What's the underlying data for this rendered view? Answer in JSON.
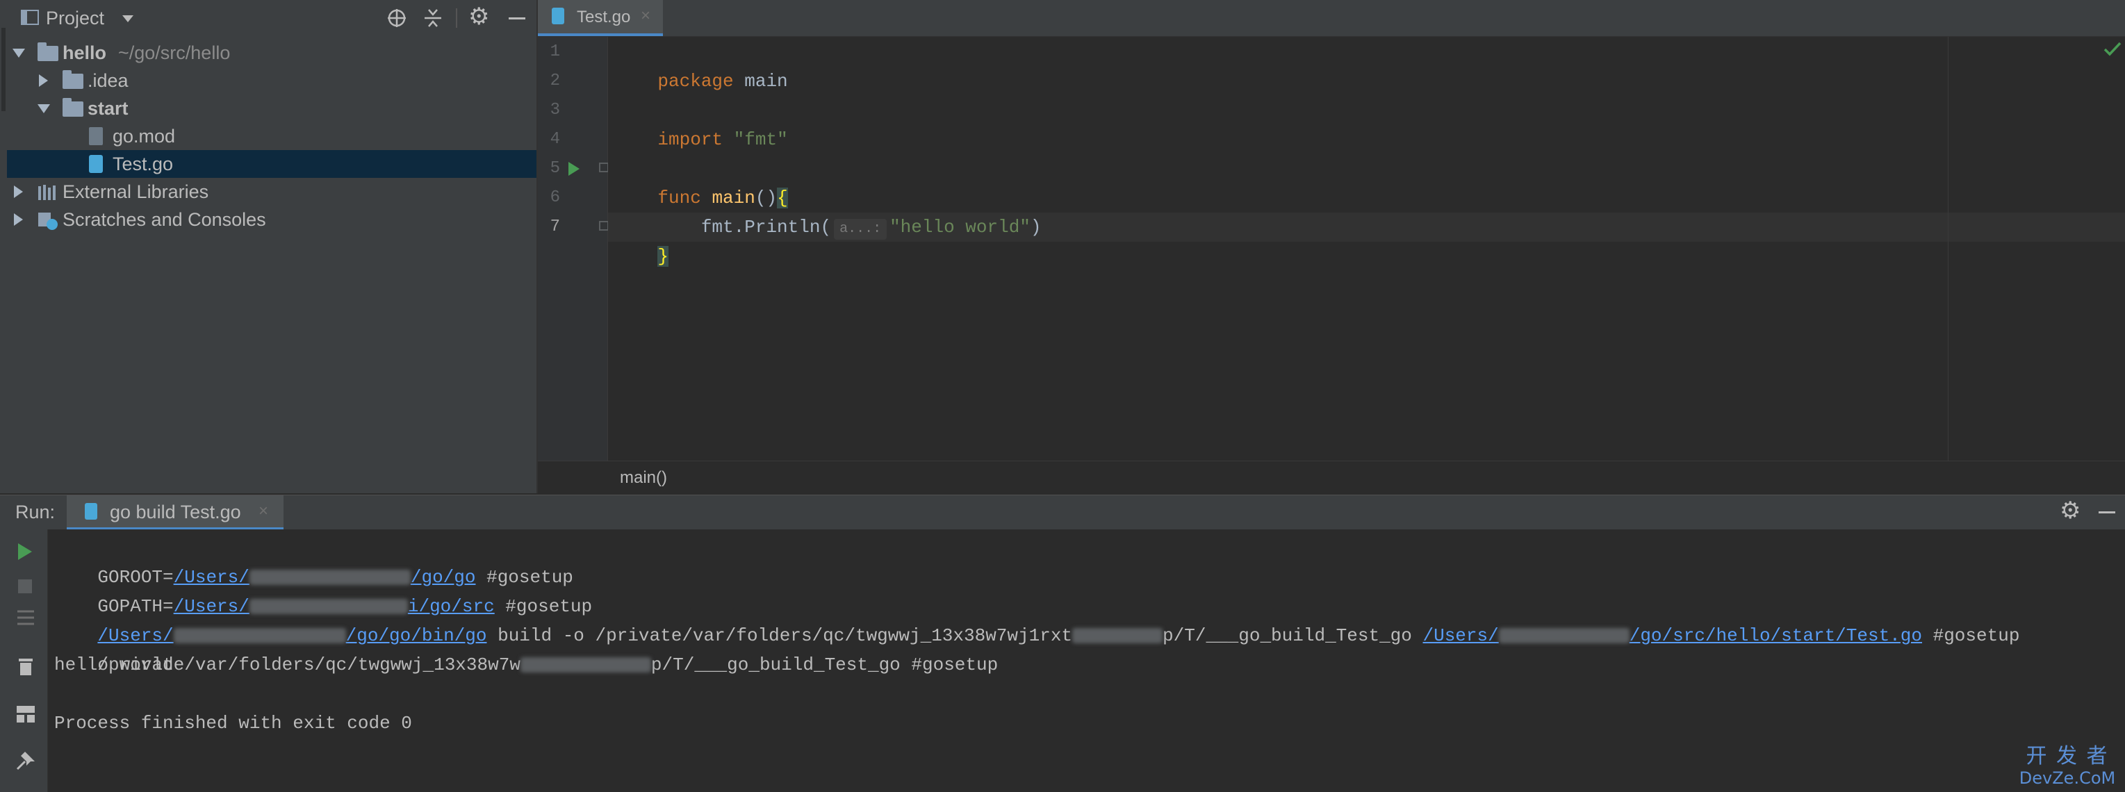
{
  "project_panel": {
    "title": "Project",
    "tree": [
      {
        "name": "hello",
        "path": "~/go/src/hello"
      },
      {
        "name": ".idea"
      },
      {
        "name": "start"
      },
      {
        "name": "go.mod"
      },
      {
        "name": "Test.go"
      },
      {
        "name": "External Libraries"
      },
      {
        "name": "Scratches and Consoles"
      }
    ]
  },
  "editor": {
    "tab_label": "Test.go",
    "line_numbers": [
      "1",
      "2",
      "3",
      "4",
      "5",
      "6",
      "7"
    ],
    "code": {
      "line1_kw": "package",
      "line1_rest": " main",
      "line3_kw": "import",
      "line3_str": "\"fmt\"",
      "line5_kw": "func",
      "line5_fn": " main",
      "line5_rest": "()",
      "line5_brace": "{",
      "line6_a": "    fmt.Println(",
      "line6_hint": "a...:",
      "line6_str": "\"hello world\"",
      "line6_b": ")",
      "line7_brace": "}"
    },
    "breadcrumb": "main()"
  },
  "run_panel": {
    "label": "Run:",
    "tab_label": "go build Test.go",
    "console": {
      "l1_a": "GOROOT=",
      "l1_link_a": "/Users/",
      "l1_link_b": "/go/go",
      "l1_tag": " #gosetup",
      "l2_a": "GOPATH=",
      "l2_link_a": "/Users/",
      "l2_link_b": "i/go/src",
      "l2_tag": " #gosetup",
      "l3_link_a": "/Users/",
      "l3_link_b": "/go/go/bin/go",
      "l3_mid_a": " build -o /private/var/folders/qc/twgwwj_13x38w7wj1rxt",
      "l3_mid_b": "p/T/___go_build_Test_go ",
      "l3_link_c": "/Users/",
      "l3_link_d": "/go/src/hello/start/Test.go",
      "l3_tag": " #gosetup",
      "l4_a": "/private/var/folders/qc/twgwwj_13x38w7w",
      "l4_b": "p/T/___go_build_Test_go #gosetup",
      "l5": "hello world",
      "l7": "Process finished with exit code 0"
    }
  },
  "watermark": {
    "line1": "开 发 者",
    "line2": "DevZe.CoM"
  },
  "colors": {
    "accent": "#4a88c7",
    "keyword": "#cc7832",
    "function": "#ffc66d",
    "string": "#6a8759",
    "link": "#589df6"
  }
}
